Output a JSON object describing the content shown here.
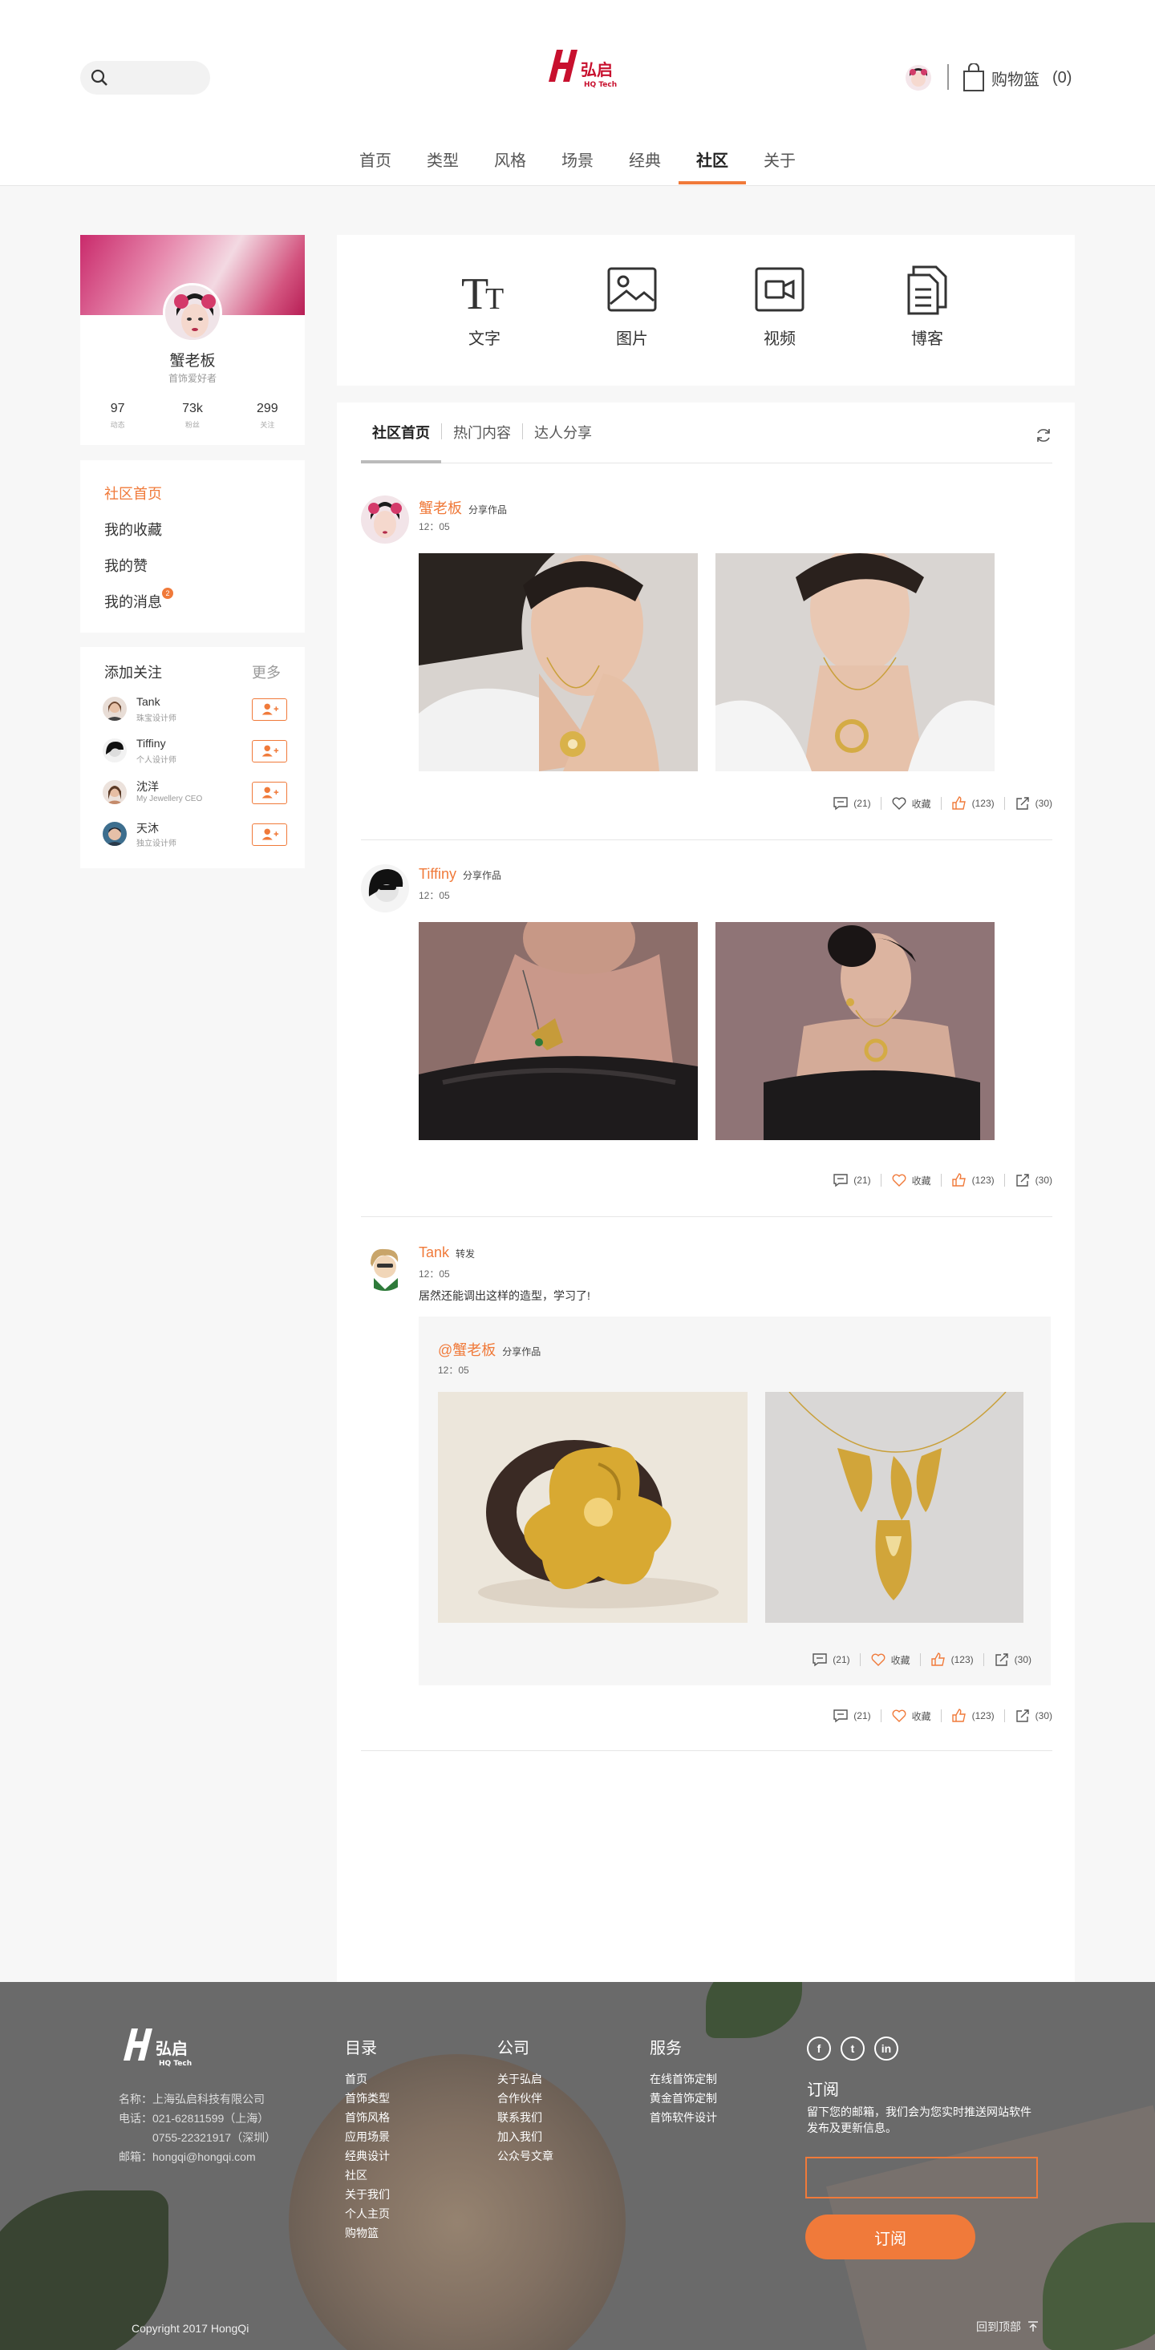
{
  "header": {
    "logo_text": "弘启",
    "logo_sub": "HQ Tech",
    "cart_label": "购物篮",
    "cart_count": "(0)"
  },
  "nav": {
    "items": [
      "首页",
      "类型",
      "风格",
      "场景",
      "经典",
      "社区",
      "关于"
    ],
    "active": "社区"
  },
  "profile": {
    "name": "蟹老板",
    "subtitle": "首饰爱好者",
    "stats": [
      {
        "value": "97",
        "label": "动态"
      },
      {
        "value": "73k",
        "label": "粉丝"
      },
      {
        "value": "299",
        "label": "关注"
      }
    ]
  },
  "menu": {
    "items": [
      "社区首页",
      "我的收藏",
      "我的赞",
      "我的消息"
    ],
    "badge": "2"
  },
  "follow": {
    "title": "添加关注",
    "more": "更多",
    "users": [
      {
        "name": "Tank",
        "role": "珠宝设计师"
      },
      {
        "name": "Tiffiny",
        "role": "个人设计师"
      },
      {
        "name": "沈洋",
        "role": "My Jewellery CEO"
      },
      {
        "name": "天沐",
        "role": "独立设计师"
      }
    ]
  },
  "post_types": [
    "文字",
    "图片",
    "视频",
    "博客"
  ],
  "tabs": [
    "社区首页",
    "热门内容",
    "达人分享"
  ],
  "posts": [
    {
      "author": "蟹老板",
      "action": "分享作品",
      "time": "12：05",
      "comments": "(21)",
      "fav": "收藏",
      "likes": "(123)",
      "shares": "(30)"
    },
    {
      "author": "Tiffiny",
      "action": "分享作品",
      "time": "12：05",
      "comments": "(21)",
      "fav": "收藏",
      "likes": "(123)",
      "shares": "(30)"
    },
    {
      "author": "Tank",
      "action": "转发",
      "time": "12：05",
      "text": "居然还能调出这样的造型，学习了!",
      "comments": "(21)",
      "fav": "收藏",
      "likes": "(123)",
      "shares": "(30)",
      "repost": {
        "author": "@蟹老板",
        "action": "分享作品",
        "time": "12：05",
        "comments": "(21)",
        "fav": "收藏",
        "likes": "(123)",
        "shares": "(30)"
      }
    }
  ],
  "footer": {
    "info": [
      "名称：上海弘启科技有限公司",
      "电话：021-62811599（上海）",
      "0755-22321917（深圳）",
      "邮箱：hongqi@hongqi.com"
    ],
    "cols": [
      {
        "title": "目录",
        "items": [
          "首页",
          "首饰类型",
          "首饰风格",
          "应用场景",
          "经典设计",
          "社区",
          "关于我们",
          "个人主页",
          "购物篮"
        ]
      },
      {
        "title": "公司",
        "items": [
          "关于弘启",
          "合作伙伴",
          "联系我们",
          "加入我们",
          "公众号文章"
        ]
      },
      {
        "title": "服务",
        "items": [
          "在线首饰定制",
          "黄金首饰定制",
          "首饰软件设计"
        ]
      }
    ],
    "subscribe_title": "订阅",
    "subscribe_desc": "留下您的邮箱，我们会为您实时推送网站软件发布及更新信息。",
    "subscribe_btn": "订阅",
    "copyright": "Copyright 2017 HongQi",
    "to_top": "回到顶部"
  },
  "colors": {
    "accent": "#f07a3a",
    "footer_bg": "#6a6a6a"
  }
}
